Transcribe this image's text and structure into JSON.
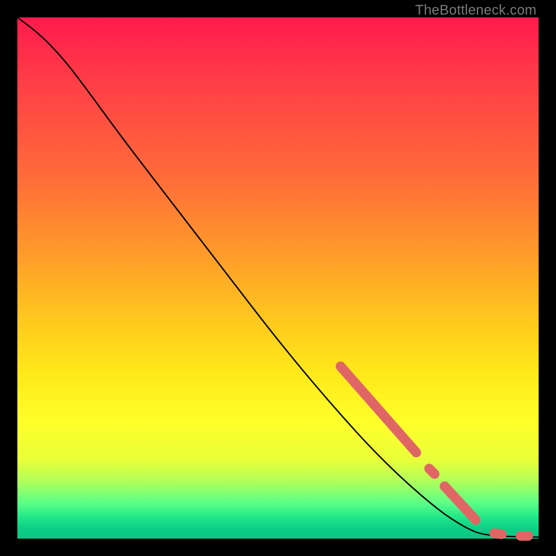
{
  "attribution": "TheBottleneck.com",
  "colors": {
    "marker": "#e06666",
    "curve": "#000000"
  },
  "chart_data": {
    "type": "line",
    "title": "",
    "xlabel": "",
    "ylabel": "",
    "xlim": [
      0,
      100
    ],
    "ylim": [
      0,
      100
    ],
    "grid": false,
    "legend": false,
    "curve": [
      {
        "x": 0,
        "y": 100
      },
      {
        "x": 4,
        "y": 97
      },
      {
        "x": 8,
        "y": 93
      },
      {
        "x": 12,
        "y": 88
      },
      {
        "x": 20,
        "y": 77
      },
      {
        "x": 30,
        "y": 64
      },
      {
        "x": 40,
        "y": 51
      },
      {
        "x": 50,
        "y": 38
      },
      {
        "x": 60,
        "y": 26
      },
      {
        "x": 70,
        "y": 15
      },
      {
        "x": 80,
        "y": 6
      },
      {
        "x": 86,
        "y": 2
      },
      {
        "x": 90,
        "y": 0.5
      },
      {
        "x": 100,
        "y": 0.3
      }
    ],
    "markers": [
      {
        "x": 62,
        "y": 33
      },
      {
        "x": 63,
        "y": 32
      },
      {
        "x": 64,
        "y": 30.5
      },
      {
        "x": 65,
        "y": 29.5
      },
      {
        "x": 66,
        "y": 28
      },
      {
        "x": 67,
        "y": 27
      },
      {
        "x": 68.5,
        "y": 25
      },
      {
        "x": 70,
        "y": 23.5
      },
      {
        "x": 71,
        "y": 22.5
      },
      {
        "x": 72.5,
        "y": 21
      },
      {
        "x": 73.5,
        "y": 19.5
      },
      {
        "x": 75,
        "y": 18
      },
      {
        "x": 76.5,
        "y": 16.5
      },
      {
        "x": 79,
        "y": 13.5
      },
      {
        "x": 80,
        "y": 12.5
      },
      {
        "x": 82,
        "y": 10
      },
      {
        "x": 83.5,
        "y": 8.5
      },
      {
        "x": 85,
        "y": 6.8
      },
      {
        "x": 86.5,
        "y": 5
      },
      {
        "x": 88,
        "y": 3.5
      },
      {
        "x": 91.5,
        "y": 1
      },
      {
        "x": 93,
        "y": 0.8
      },
      {
        "x": 96.5,
        "y": 0.5
      },
      {
        "x": 98,
        "y": 0.5
      }
    ]
  }
}
